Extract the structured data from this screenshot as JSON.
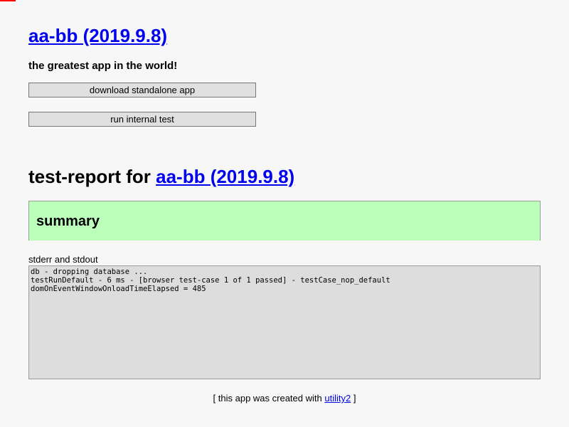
{
  "progress": {
    "fraction": 0.0275,
    "color": "#ff0000"
  },
  "header": {
    "app_link": "aa-bb (2019.9.8)",
    "tagline": "the greatest app in the world!"
  },
  "buttons": {
    "download_label": "download standalone app",
    "test_label": "run internal test"
  },
  "report": {
    "title_prefix": "test-report for ",
    "title_link": "aa-bb (2019.9.8)",
    "summary_heading": "summary",
    "summary_color": "#bbffbb"
  },
  "console": {
    "label": "stderr and stdout",
    "lines": [
      "db - dropping database ...",
      "testRunDefault - 6 ms - [browser test-case 1 of 1 passed] - testCase_nop_default",
      "domOnEventWindowOnloadTimeElapsed = 485"
    ]
  },
  "footer": {
    "prefix": "[ this app was created with ",
    "link": "utility2",
    "suffix": " ]"
  }
}
